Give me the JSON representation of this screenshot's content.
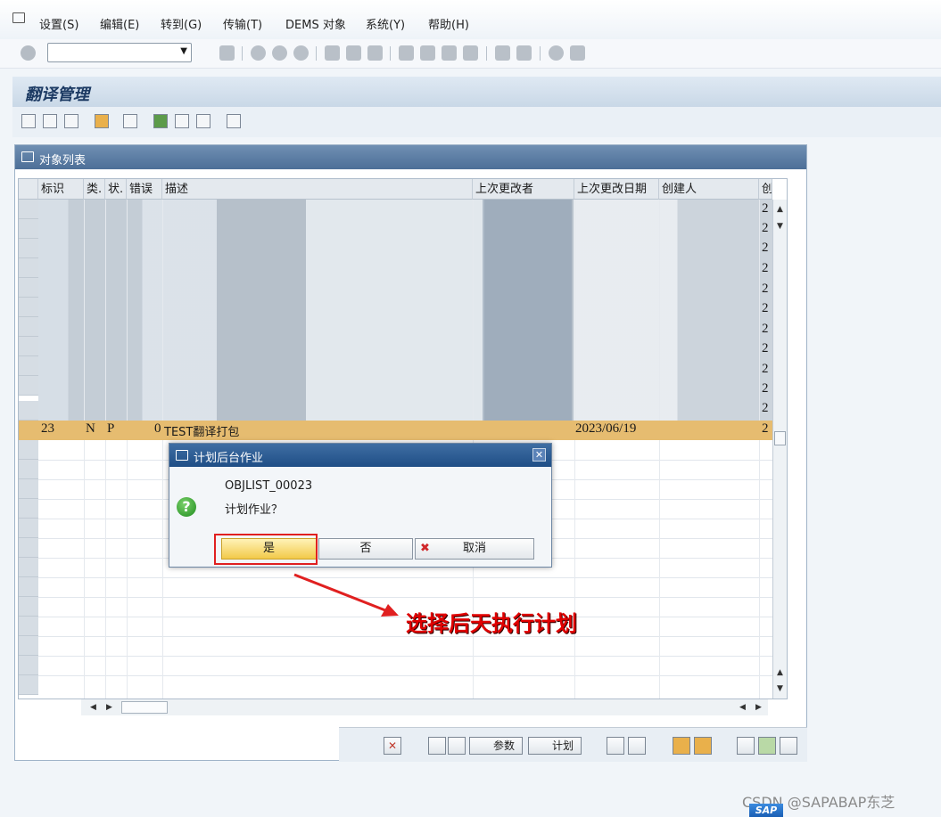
{
  "menu": {
    "items": [
      "设置(S)",
      "编辑(E)",
      "转到(G)",
      "传输(T)",
      "DEMS 对象",
      "系统(Y)",
      "帮助(H)"
    ]
  },
  "page_title": "翻译管理",
  "panel": {
    "title": "对象列表"
  },
  "grid": {
    "columns": [
      "标识",
      "类.",
      "状.",
      "错误",
      "描述",
      "上次更改者",
      "上次更改日期",
      "创建人",
      "创"
    ],
    "row_counts": [
      "2",
      "2",
      "2",
      "2",
      "2",
      "2",
      "2",
      "2",
      "2",
      "2",
      "2"
    ],
    "selected_row": {
      "id": "23",
      "type": "N",
      "status": "P",
      "errors": "0",
      "description": "TEST翻译打包",
      "changed_on": "2023/06/19",
      "last_col": "2"
    }
  },
  "footer": {
    "params_label": "参数",
    "schedule_label": "计划"
  },
  "dialog": {
    "title": "计划后台作业",
    "line1": "OBJLIST_00023",
    "line2": "计划作业？",
    "yes_label": "是",
    "no_label": "否",
    "cancel_label": "取消"
  },
  "annotation": "选择后天执行计划",
  "watermark": "CSDN @SAPABAP东芝",
  "logo": "SAP",
  "colors": {
    "highlight_row": "#e6bc70",
    "dialog_header": "#1f4e86",
    "annotation": "#e00000"
  }
}
